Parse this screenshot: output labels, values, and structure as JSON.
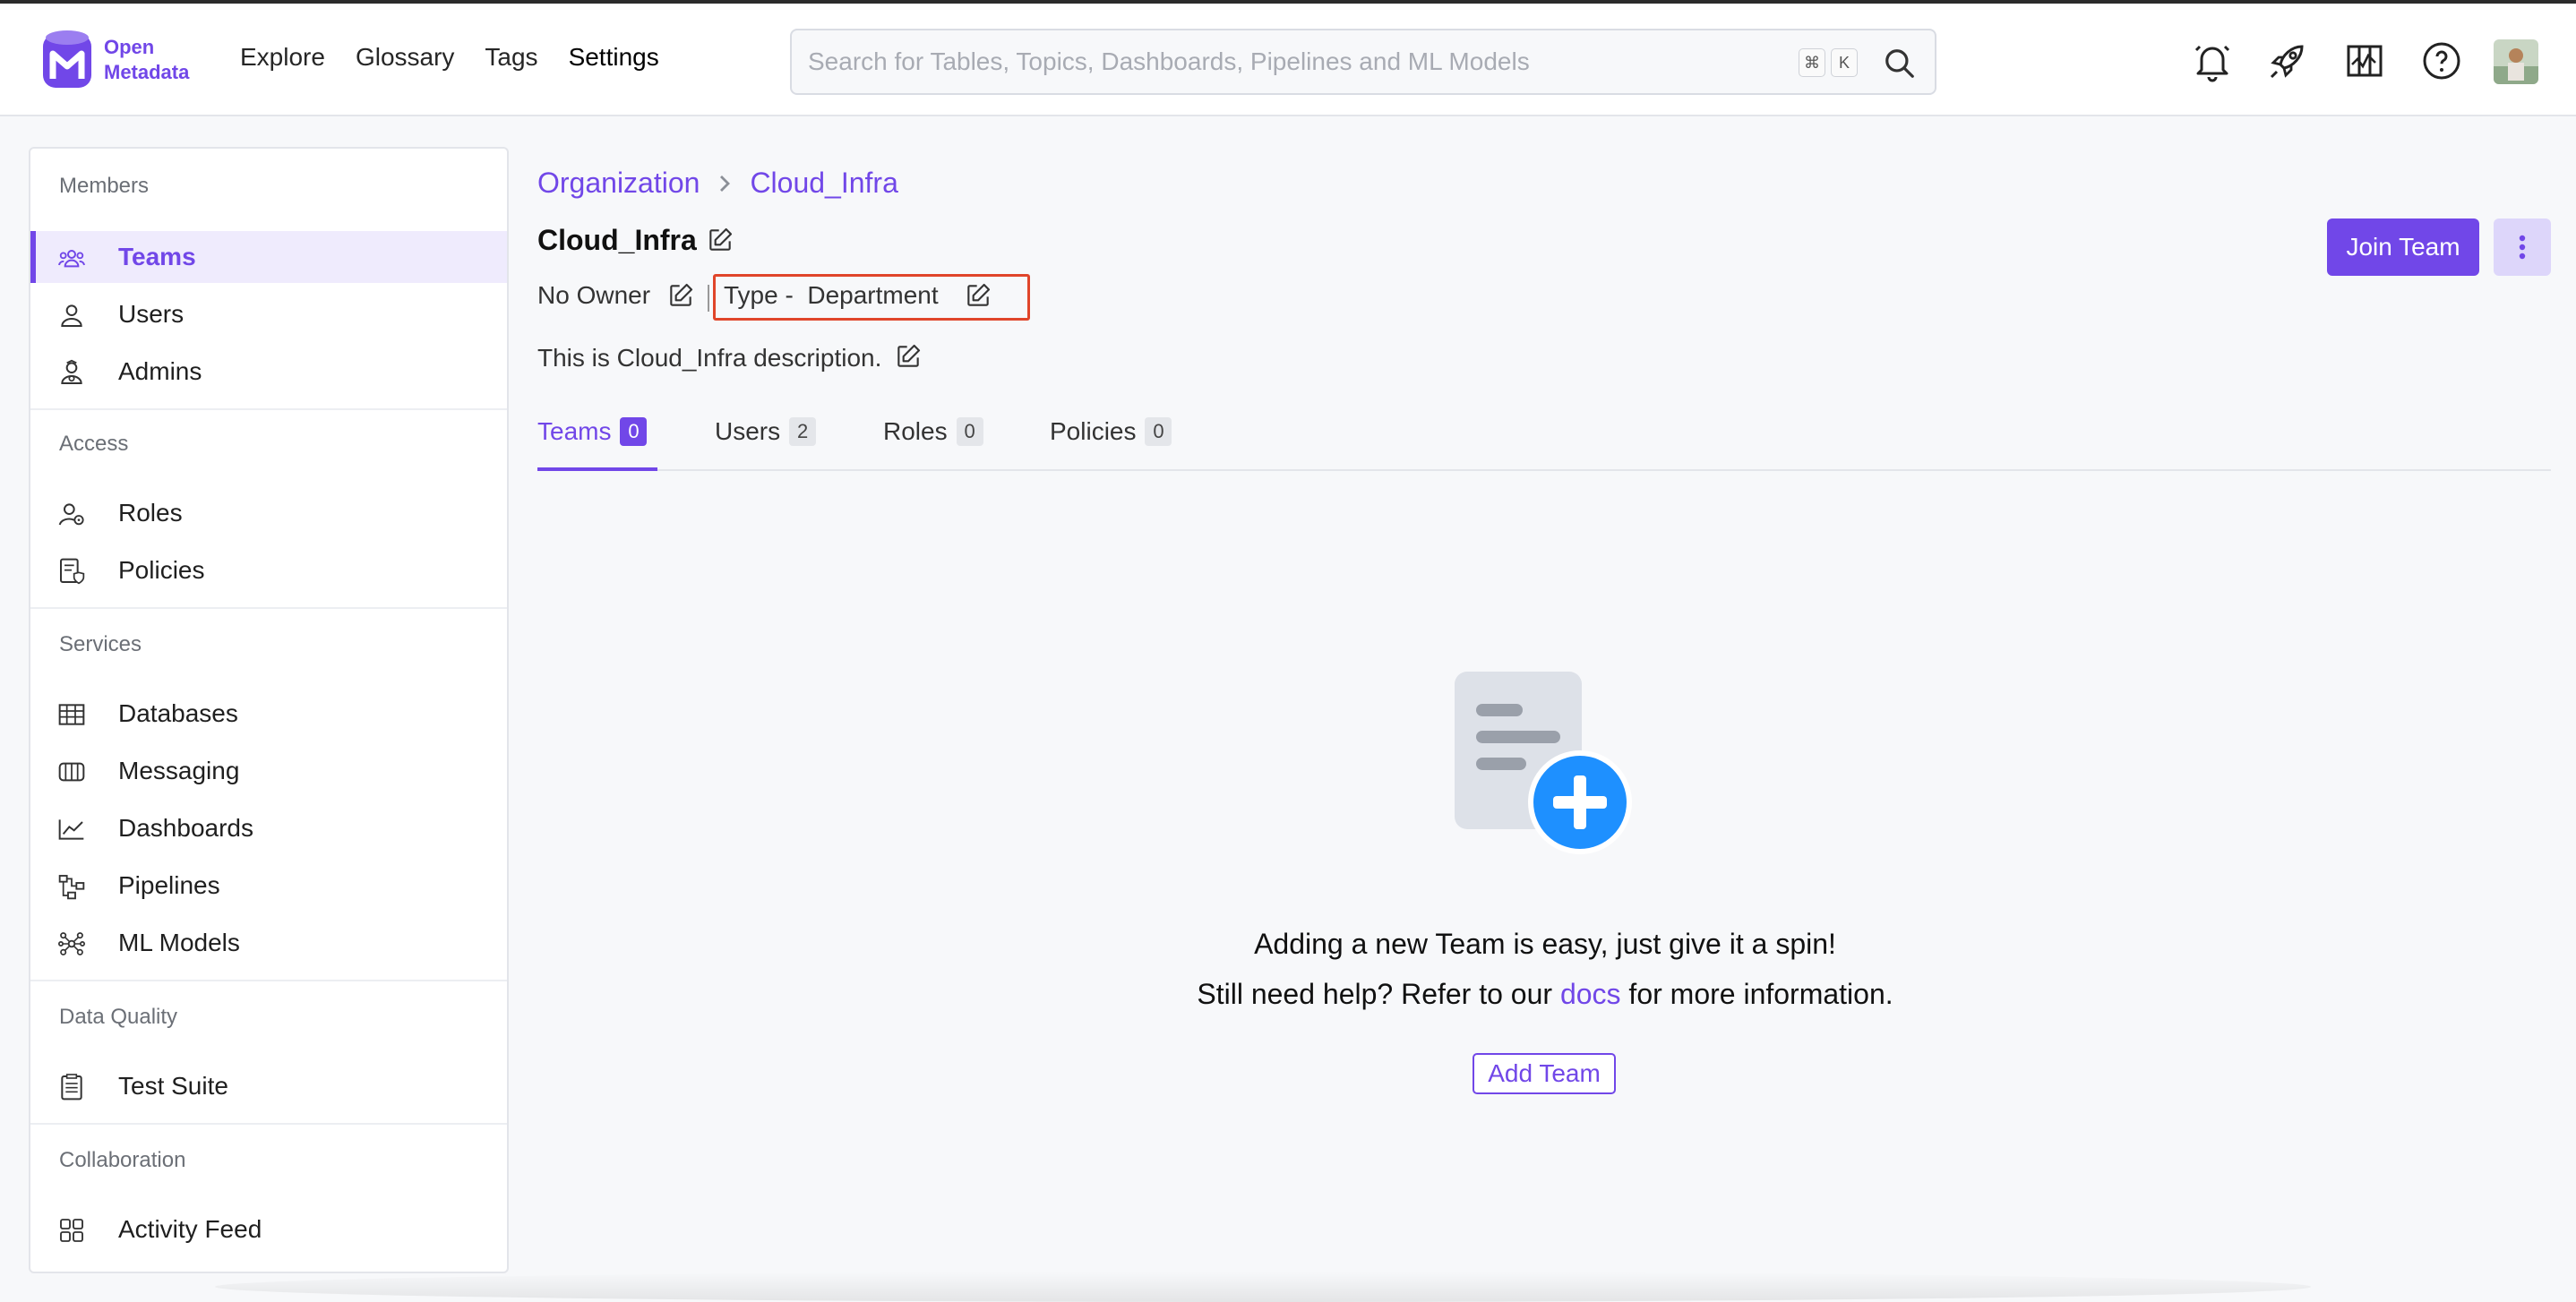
{
  "brand": {
    "logo_line1": "Open",
    "logo_line2": "Metadata",
    "accent_color": "#7147e8"
  },
  "nav": {
    "items": [
      {
        "label": "Explore"
      },
      {
        "label": "Glossary"
      },
      {
        "label": "Tags"
      },
      {
        "label": "Settings"
      }
    ]
  },
  "search": {
    "placeholder": "Search for Tables, Topics, Dashboards, Pipelines and ML Models",
    "value": "",
    "shortcut_keys": [
      "⌘",
      "K"
    ]
  },
  "header_icons": [
    "bell-icon",
    "rocket-icon",
    "tour-map-icon",
    "help-icon",
    "user-avatar"
  ],
  "sidebar": {
    "sections": [
      {
        "title": "Members",
        "items": [
          {
            "label": "Teams",
            "icon": "teams-icon",
            "active": true
          },
          {
            "label": "Users",
            "icon": "user-icon"
          },
          {
            "label": "Admins",
            "icon": "admin-icon"
          }
        ]
      },
      {
        "title": "Access",
        "items": [
          {
            "label": "Roles",
            "icon": "roles-icon"
          },
          {
            "label": "Policies",
            "icon": "policies-icon"
          }
        ]
      },
      {
        "title": "Services",
        "items": [
          {
            "label": "Databases",
            "icon": "database-icon"
          },
          {
            "label": "Messaging",
            "icon": "messaging-icon"
          },
          {
            "label": "Dashboards",
            "icon": "dashboard-icon"
          },
          {
            "label": "Pipelines",
            "icon": "pipeline-icon"
          },
          {
            "label": "ML Models",
            "icon": "ml-model-icon"
          }
        ]
      },
      {
        "title": "Data Quality",
        "items": [
          {
            "label": "Test Suite",
            "icon": "test-suite-icon"
          }
        ]
      },
      {
        "title": "Collaboration",
        "items": [
          {
            "label": "Activity Feed",
            "icon": "activity-feed-icon"
          }
        ]
      }
    ]
  },
  "breadcrumb": [
    "Organization",
    "Cloud_Infra"
  ],
  "team": {
    "name": "Cloud_Infra",
    "owner": "No Owner",
    "type_text": "Type -  Department",
    "description": "This is Cloud_Infra description."
  },
  "actions": {
    "join_label": "Join Team"
  },
  "tabs": [
    {
      "label": "Teams",
      "count": "0",
      "active": true
    },
    {
      "label": "Users",
      "count": "2"
    },
    {
      "label": "Roles",
      "count": "0"
    },
    {
      "label": "Policies",
      "count": "0"
    }
  ],
  "empty_state": {
    "line1": "Adding a new Team is easy, just give it a spin!",
    "line2_before": "Still need help? Refer to our ",
    "line2_link": "docs",
    "line2_after": " for more information.",
    "button_label": "Add Team"
  }
}
